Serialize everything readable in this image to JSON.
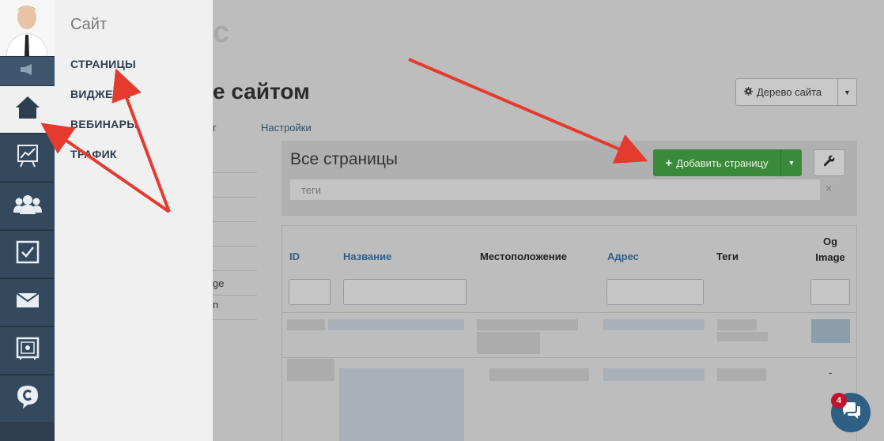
{
  "flyout": {
    "title": "Сайт",
    "items": [
      {
        "label": "СТРАНИЦЫ"
      },
      {
        "label": "ВИДЖЕТЫ"
      },
      {
        "label": "ВЕБИНАРЫ"
      },
      {
        "label": "ТРАФИК"
      }
    ]
  },
  "rail": {
    "icons": [
      "megaphone-icon",
      "home-icon",
      "chart-icon",
      "users-icon",
      "checkbox-icon",
      "mail-icon",
      "safe-icon",
      "logo-icon"
    ]
  },
  "page": {
    "ghost_title": "с",
    "title": "е сайтом",
    "tree_button": "Дерево сайта",
    "tabs": [
      "г",
      "Настройки"
    ],
    "left_list": [
      "",
      "",
      "",
      "",
      "",
      "ge",
      "n"
    ],
    "panel_title": "Все страницы",
    "add_button": "Добавить страницу",
    "tags_placeholder": "теги",
    "tags_clear": "×",
    "table": {
      "headers": {
        "id": "ID",
        "name": "Название",
        "location": "Местоположение",
        "address": "Адрес",
        "tags": "Теги",
        "og_line1": "Og",
        "og_line2": "Image"
      },
      "row2_og": "-"
    }
  },
  "chat": {
    "badge": "4"
  },
  "colors": {
    "rail": "#2c3e50",
    "flyout": "#f0f0f0",
    "accent_green": "#3a8a3a",
    "arrow_red": "#e53b2f",
    "link_blue": "#2c5f8e"
  }
}
